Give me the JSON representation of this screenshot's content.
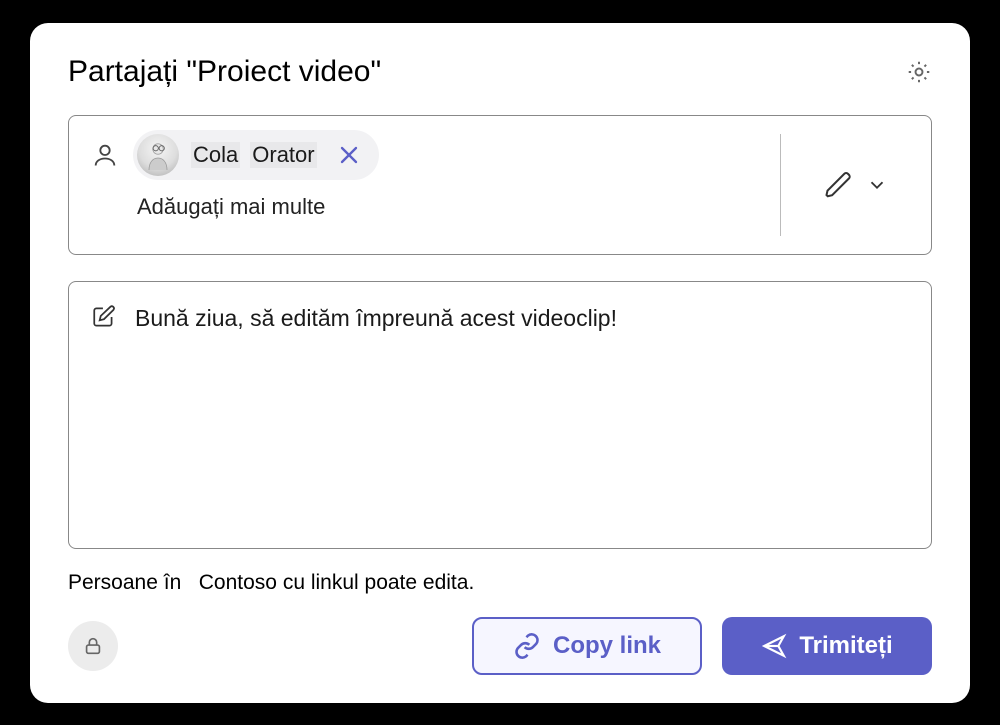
{
  "title": "Partajați \"Proiect video\"",
  "recipient": {
    "first": "Cola",
    "last": "Orator"
  },
  "add_more": "Adăugați mai multe",
  "message": "Bună ziua, să edităm împreună acest videoclip!",
  "permission": {
    "label": "Persoane în",
    "detail": "Contoso cu linkul poate edita."
  },
  "buttons": {
    "copy": "Copy link",
    "send": "Trimiteți"
  },
  "colors": {
    "accent": "#5b5fc7"
  }
}
